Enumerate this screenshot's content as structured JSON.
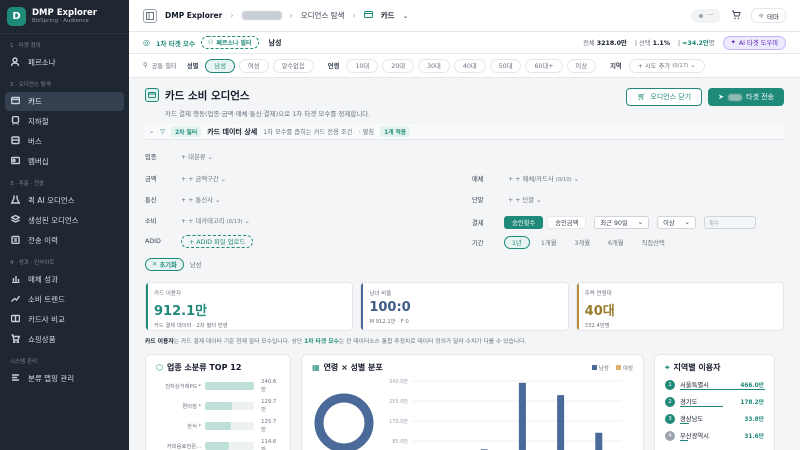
{
  "brand": {
    "title": "DMP Explorer",
    "subtitle": "BizSpring · Audience",
    "logo": "D"
  },
  "sidebar": {
    "sections": [
      {
        "label": "1 · 타겟 정의",
        "items": [
          {
            "label": "페르소나",
            "icon": "persona-icon"
          }
        ]
      },
      {
        "label": "2 · 오디언스 탐색",
        "items": [
          {
            "label": "카드",
            "icon": "card-icon",
            "active": true
          },
          {
            "label": "지하철",
            "icon": "subway-icon"
          },
          {
            "label": "버스",
            "icon": "bus-icon"
          },
          {
            "label": "멤버십",
            "icon": "membership-icon"
          }
        ]
      },
      {
        "label": "3 · 추출 · 전송",
        "items": [
          {
            "label": "퀵 AI 오디언스",
            "icon": "flask-icon"
          },
          {
            "label": "생성된 오디언스",
            "icon": "layers-icon"
          },
          {
            "label": "전송 이력",
            "icon": "clipboard-icon"
          }
        ]
      },
      {
        "label": "4 · 성과 · 인사이트",
        "items": [
          {
            "label": "매체 성과",
            "icon": "bar-chart-icon"
          },
          {
            "label": "소비 트렌드",
            "icon": "trend-icon"
          },
          {
            "label": "카드사 비교",
            "icon": "compare-icon"
          },
          {
            "label": "쇼핑상품",
            "icon": "cart-icon"
          }
        ]
      },
      {
        "label": "시스템 관리",
        "items": [
          {
            "label": "분류 맵핑 관리",
            "icon": "mapping-icon"
          }
        ]
      }
    ]
  },
  "topbar": {
    "crumb_root": "DMP Explorer",
    "crumb_section": "오디언스 탐색",
    "crumb_current": "카드",
    "status_dots": "···",
    "theme_label": "테마"
  },
  "target": {
    "label": "1차 타겟 모수",
    "persona_filter": "페르소나 필터",
    "gender": "남성",
    "total_label": "전체",
    "total_value": "3218.0만",
    "selected_label": "선택",
    "selected_value": "1.1%",
    "target_value": "≈34.2만",
    "target_unit": "명",
    "ai_button": "AI 타겟 도우미"
  },
  "filters": {
    "common_label": "공통 필터",
    "gender_label": "성별",
    "gender_options": [
      {
        "label": "남성",
        "on": true
      },
      {
        "label": "여성",
        "on": false
      },
      {
        "label": "알수없음",
        "on": false
      }
    ],
    "age_label": "연령",
    "age_options": [
      "10대",
      "20대",
      "30대",
      "40대",
      "50대",
      "60대+",
      "이상"
    ],
    "region_label": "지역",
    "region_add": "+ 시도 추가",
    "region_count": "(0/17)"
  },
  "page": {
    "title": "카드 소비 오디언스",
    "subtitle": "카드 결제 행동(업종·금액·매체·통신·결제)으로 1차 타겟 모수를 정제합니다.",
    "close_button": "오디언스 닫기",
    "send_button": "타겟 전송"
  },
  "card_detail": {
    "badge": "2차 필터",
    "title": "카드 데이터 상세",
    "desc": "1차 모수를 좁히는 카드 전용 조건",
    "fold": "· 펼침",
    "applied": "1개 적용"
  },
  "detail_filters": {
    "industry": {
      "label": "업종",
      "value": "+ 대분류"
    },
    "amount": {
      "label": "금액",
      "value": "+ + 금액구간"
    },
    "telecom": {
      "label": "통신",
      "value": "+ + 통신사"
    },
    "consume": {
      "label": "소비",
      "value": "+ + 대카테고리",
      "count": "(0/13)"
    },
    "adid": {
      "label": "ADID",
      "button": "+ ADID 파일 업로드"
    },
    "media": {
      "label": "매체",
      "value": "+ + 매체/카드사",
      "count": "(0/10)"
    },
    "unit": {
      "label": "단말",
      "value": "+ + 단말"
    },
    "payment": {
      "label": "결제",
      "options": [
        {
          "label": "승인횟수",
          "on": true
        },
        {
          "label": "승인금액",
          "on": false
        }
      ],
      "period_select": "최근 90일",
      "compare_select": "이상",
      "input_placeholder": "횟수"
    },
    "duration": {
      "label": "기간",
      "options": [
        {
          "label": "1년",
          "on": true
        },
        {
          "label": "1개월",
          "on": false
        },
        {
          "label": "3개월",
          "on": false
        },
        {
          "label": "6개월",
          "on": false
        },
        {
          "label": "직접선택",
          "on": false
        }
      ]
    },
    "reset": "초기화",
    "reset_tag": "남성"
  },
  "metrics": [
    {
      "label": "카드 이용자",
      "value": "912.1만",
      "sub": "카드 결제 데이터 · 2차 필터 반영"
    },
    {
      "label": "남녀 비율",
      "value": "100:0",
      "sub": "M 912.1만 · F 0"
    },
    {
      "label": "주력 연령대",
      "value": "40대",
      "sub": "332.4만명"
    }
  ],
  "note": {
    "bold": "카드 이용자",
    "text1": "는 카드 결제 데이터 기준 현재 필터 모수입니다. 상단 ",
    "highlight": "1차 타겟 모수",
    "text2": "는 전 데이터소스 통합 추정치로 데이터 정의가 달라 수치가 다를 수 있습니다."
  },
  "industry_panel": {
    "title": "업종 소분류 TOP 12",
    "rows": [
      {
        "label": "전자상거래PG *",
        "value": "240.6만",
        "ratio": 1.0
      },
      {
        "label": "편의점 *",
        "value": "129.7만",
        "ratio": 0.54
      },
      {
        "label": "한식 *",
        "value": "125.7만",
        "ratio": 0.52
      },
      {
        "label": "커피음료전문...",
        "value": "114.6만",
        "ratio": 0.48
      }
    ]
  },
  "age_panel": {
    "title": "연령 × 성별 분포",
    "legend": [
      {
        "label": "남성",
        "color": "#4a6a9a"
      },
      {
        "label": "여성",
        "color": "#e0b070"
      }
    ],
    "yticks": [
      "340.0만",
      "255.0만",
      "170.0만",
      "85.0만"
    ]
  },
  "chart_data": {
    "type": "bar",
    "title": "연령 × 성별 분포",
    "series": [
      {
        "name": "남성",
        "values": [
          15,
          50,
          332.4,
          280,
          120
        ]
      },
      {
        "name": "여성",
        "values": [
          0,
          0,
          0,
          0,
          0
        ]
      }
    ],
    "ylim": [
      0,
      340
    ]
  },
  "region_panel": {
    "title": "지역별 이용자",
    "rows": [
      {
        "rank": "1",
        "label": "서울특별시",
        "value": "466.0만",
        "ratio": 1.0
      },
      {
        "rank": "2",
        "label": "경기도",
        "value": "178.2만",
        "ratio": 0.5
      },
      {
        "rank": "3",
        "label": "경상남도",
        "value": "33.8만",
        "ratio": 0.1
      },
      {
        "rank": "4",
        "label": "부산광역시",
        "value": "31.6만",
        "ratio": 0.09
      }
    ]
  },
  "colors": {
    "accent": "#1f8a7a",
    "sidebar": "#1e2732",
    "male": "#4a6a9a",
    "female": "#e0b070"
  }
}
